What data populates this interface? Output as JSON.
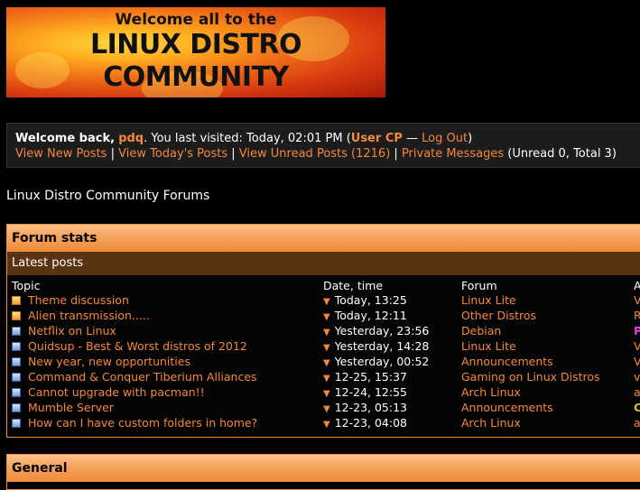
{
  "banner": {
    "line1": "Welcome all to the",
    "line2": "LINUX DISTRO",
    "line3": "COMMUNITY"
  },
  "welcome": {
    "greeting": "Welcome back,",
    "username": "pdq",
    "last_visited": ". You last visited: Today, 02:01 PM (",
    "user_cp": "User CP",
    "dash": " — ",
    "logout": "Log Out",
    "close_paren": ")",
    "links": {
      "new_posts": "View New Posts",
      "todays_posts": "View Today's Posts",
      "unread_posts": "View Unread Posts (1216)",
      "private_messages": "Private Messages",
      "pm_counts": "(Unread 0, Total 3)",
      "sep": " | "
    }
  },
  "page_title": "Linux Distro Community Forums",
  "forum_stats": {
    "title": "Forum stats",
    "subtitle": "Latest posts",
    "columns": [
      "Topic",
      "Date, time",
      "Forum",
      "A"
    ],
    "rows": [
      {
        "icon": "hot",
        "topic": "Theme discussion",
        "date": "Today, 13:25",
        "forum": "Linux Lite",
        "author": "V",
        "author_color": "#f5883d"
      },
      {
        "icon": "hot",
        "topic": "Alien transmission.....",
        "date": "Today, 12:11",
        "forum": "Other Distros",
        "author": "R",
        "author_color": "#f5883d"
      },
      {
        "icon": "norm",
        "topic": "Netflix on Linux",
        "date": "Yesterday, 23:56",
        "forum": "Debian",
        "author": "P",
        "author_color": "#e040e0"
      },
      {
        "icon": "norm",
        "topic": "Quidsup - Best & Worst distros of 2012",
        "date": "Yesterday, 14:28",
        "forum": "Linux Lite",
        "author": "V",
        "author_color": "#f5883d"
      },
      {
        "icon": "norm",
        "topic": "New year, new opportunities",
        "date": "Yesterday, 00:52",
        "forum": "Announcements",
        "author": "V",
        "author_color": "#f5883d"
      },
      {
        "icon": "norm",
        "topic": "Command & Conquer Tiberium Alliances",
        "date": "12-25, 15:37",
        "forum": "Gaming on Linux Distros",
        "author": "v",
        "author_color": "#f5883d"
      },
      {
        "icon": "norm",
        "topic": "Cannot upgrade with pacman!!",
        "date": "12-24, 12:55",
        "forum": "Arch Linux",
        "author": "a",
        "author_color": "#f5883d"
      },
      {
        "icon": "norm",
        "topic": "Mumble Server",
        "date": "12-23, 05:13",
        "forum": "Announcements",
        "author": "C",
        "author_color": "#d8c030"
      },
      {
        "icon": "norm",
        "topic": "How can I have custom folders in home?",
        "date": "12-23, 04:08",
        "forum": "Arch Linux",
        "author": "a",
        "author_color": "#f5883d"
      }
    ]
  },
  "general": {
    "title": "General"
  }
}
